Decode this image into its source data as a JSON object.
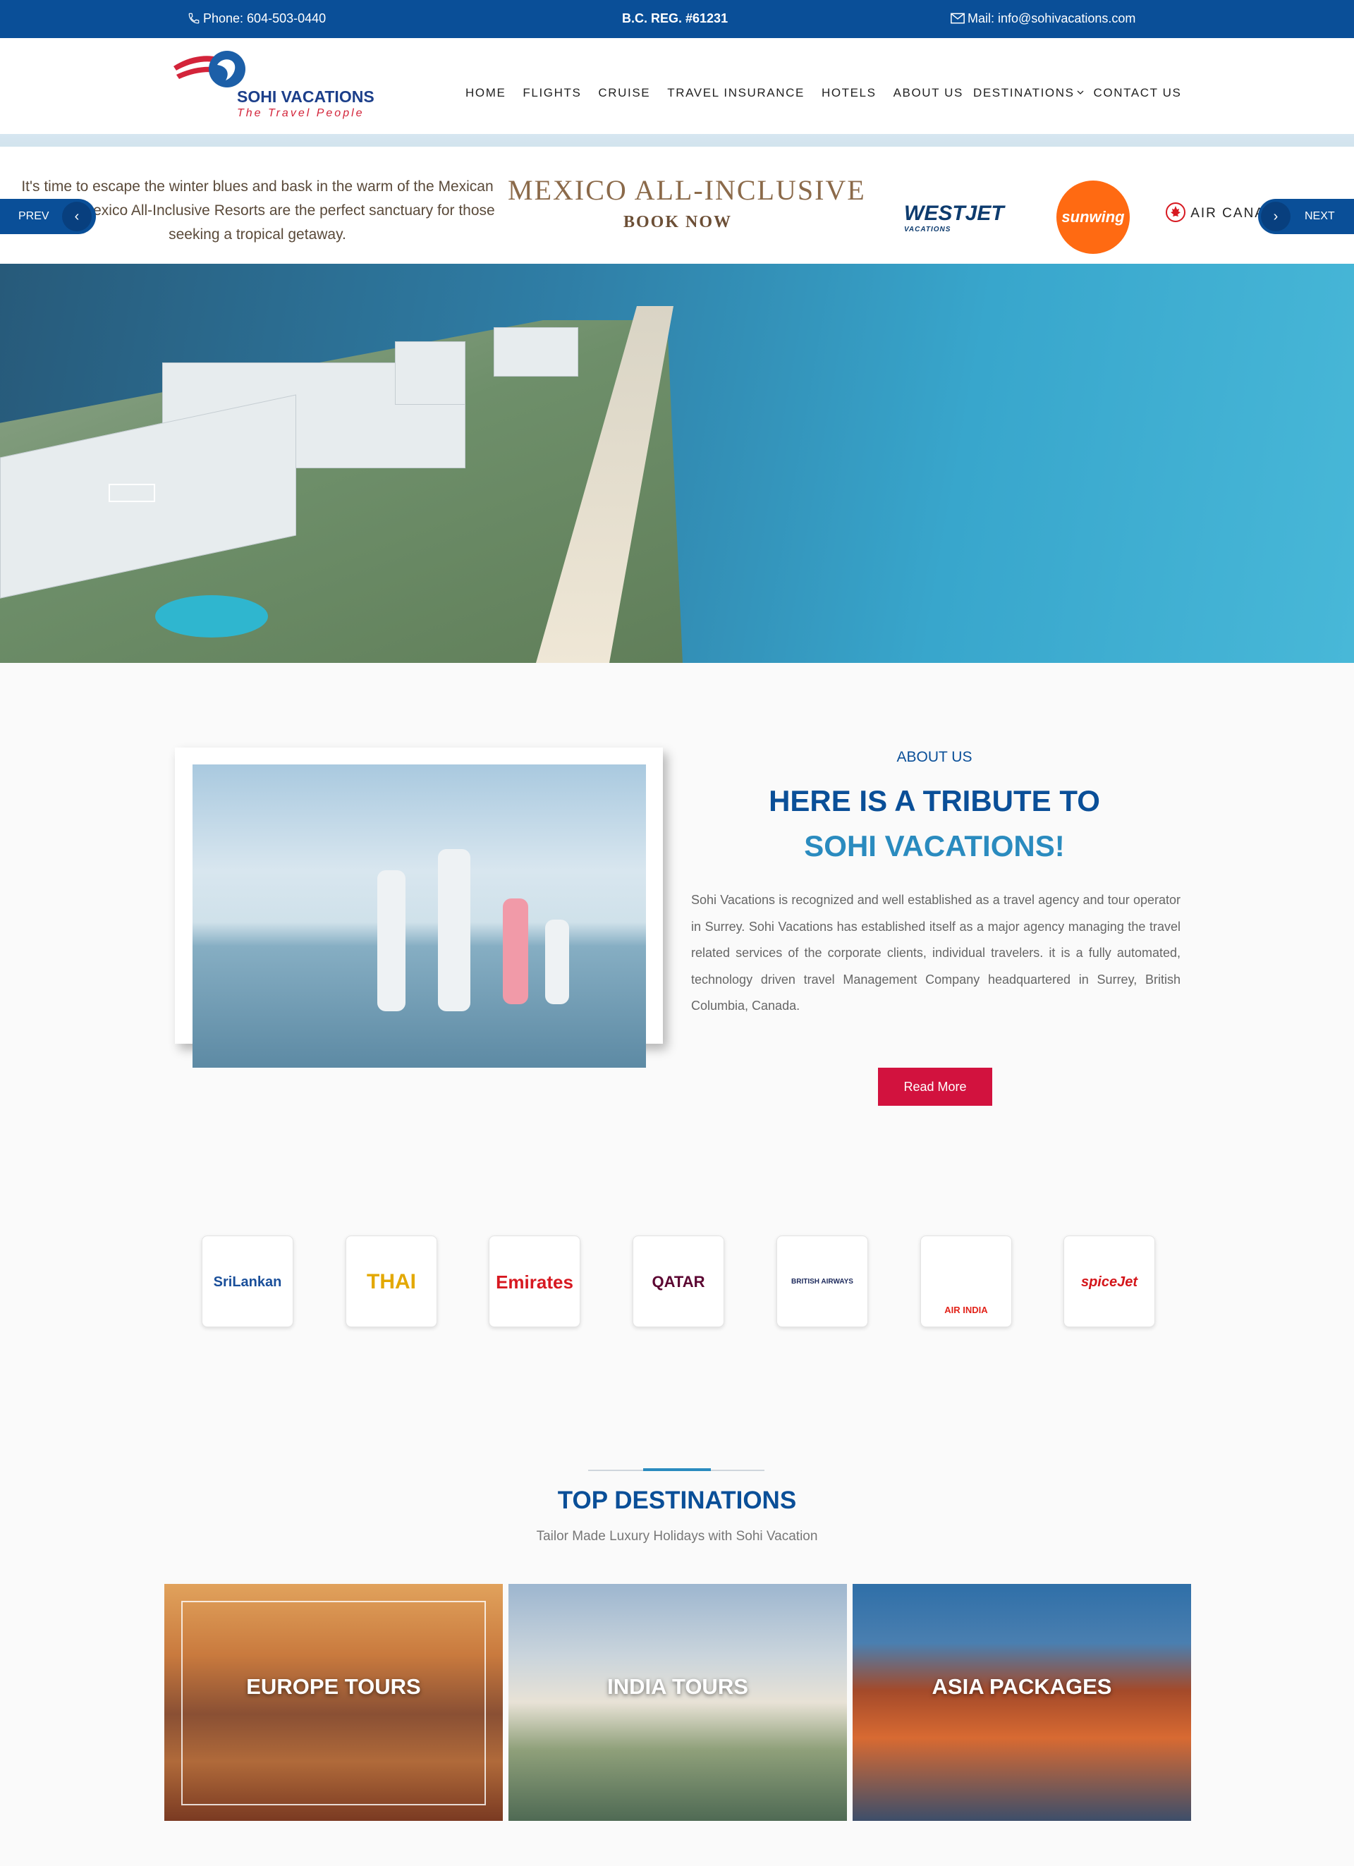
{
  "topbar": {
    "phone": "Phone: 604-503-0440",
    "reg": "B.C. REG. #61231",
    "mail": "Mail: info@sohivacations.com",
    "phone_icon": "phone-icon",
    "mail_icon": "envelope-icon"
  },
  "header": {
    "logo_text": "SOHI  VACATIONS",
    "logo_tag": "The  Travel  People",
    "nav": [
      "HOME",
      "FLIGHTS",
      "CRUISE",
      "TRAVEL INSURANCE",
      "HOTELS",
      "ABOUT US",
      "DESTINATIONS",
      "CONTACT US"
    ],
    "nav_dropdown_icon": "chevron-down-icon"
  },
  "hero": {
    "banner_text": "It's time to escape the winter blues and bask in the warm of the Mexican sun! Our Mexico All-Inclusive Resorts are the perfect sanctuary for those seeking a tropical getaway.",
    "banner_title": "MEXICO ALL-INCLUSIVE",
    "banner_cta": "BOOK NOW",
    "westjet": "WESTJET",
    "westjet_sub": "VACATIONS",
    "sunwing": "sunwing",
    "aircanada": "AIR CANADA VACATIONS",
    "prev": "PREV",
    "next": "NEXT"
  },
  "about": {
    "kicker": "ABOUT US",
    "title_line1": "HERE IS A TRIBUTE TO",
    "title_line2": "SOHI VACATIONS!",
    "body": "Sohi Vacations is recognized and well established as a travel agency and tour operator in Surrey. Sohi Vacations has established itself as a major agency managing the travel related services of the corporate clients, individual travelers. it is a fully automated, technology driven travel Management Company headquartered in Surrey, British Columbia, Canada.",
    "read_more": "Read More"
  },
  "partners": [
    {
      "name": "SriLankan",
      "color": "#1a4f9a"
    },
    {
      "name": "THAI",
      "color": "#e3a800"
    },
    {
      "name": "Emirates",
      "color": "#d71921"
    },
    {
      "name": "QATAR",
      "color": "#5c0632"
    },
    {
      "name": "BRITISH AIRWAYS",
      "color": "#1d2a5c"
    },
    {
      "name": "AIR INDIA",
      "color": "#e2231a"
    },
    {
      "name": "spiceJet",
      "color": "#d4161b"
    }
  ],
  "destinations": {
    "title": "TOP DESTINATIONS",
    "subtitle": "Tailor Made Luxury Holidays with Sohi Vacation",
    "cards": [
      {
        "label": "EUROPE TOURS"
      },
      {
        "label": "INDIA TOURS"
      },
      {
        "label": "ASIA PACKAGES"
      }
    ]
  },
  "colors": {
    "brand": "#0a4f98",
    "accent": "#2a8bbf",
    "cta": "#d2123e"
  }
}
